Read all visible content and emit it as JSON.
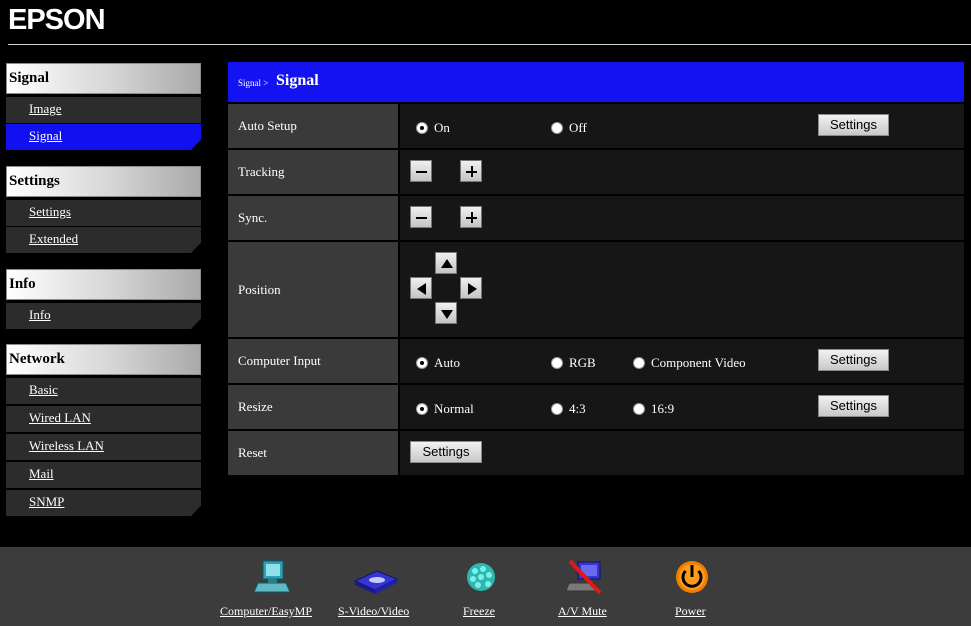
{
  "brand": "EPSON",
  "sidebar": {
    "signal_header": "Signal",
    "signal_items": [
      "Image",
      "Signal"
    ],
    "settings_header": "Settings",
    "settings_items": [
      "Settings",
      "Extended"
    ],
    "info_header": "Info",
    "info_items": [
      "Info"
    ],
    "network_header": "Network",
    "network_items": [
      "Basic",
      "Wired LAN",
      "Wireless LAN",
      "Mail",
      "SNMP"
    ],
    "active_item": "Signal"
  },
  "breadcrumb": {
    "parent": "Signal >",
    "current": "Signal"
  },
  "rows": {
    "auto_setup": {
      "label": "Auto Setup",
      "options": [
        "On",
        "Off"
      ],
      "selected": "On",
      "button": "Settings"
    },
    "tracking": {
      "label": "Tracking"
    },
    "sync": {
      "label": "Sync."
    },
    "position": {
      "label": "Position"
    },
    "computer_input": {
      "label": "Computer Input",
      "options": [
        "Auto",
        "RGB",
        "Component Video"
      ],
      "selected": "Auto",
      "button": "Settings"
    },
    "resize": {
      "label": "Resize",
      "options": [
        "Normal",
        "4:3",
        "16:9"
      ],
      "selected": "Normal",
      "button": "Settings"
    },
    "reset": {
      "label": "Reset",
      "button": "Settings"
    }
  },
  "toolbar": {
    "computer": "Computer/EasyMP",
    "svideo": "S-Video/Video",
    "freeze": "Freeze",
    "avmute": "A/V Mute",
    "power": "Power"
  },
  "colors": {
    "accent_blue": "#1313f2",
    "active_item": "#1010f0",
    "power_orange": "#f07f00"
  }
}
